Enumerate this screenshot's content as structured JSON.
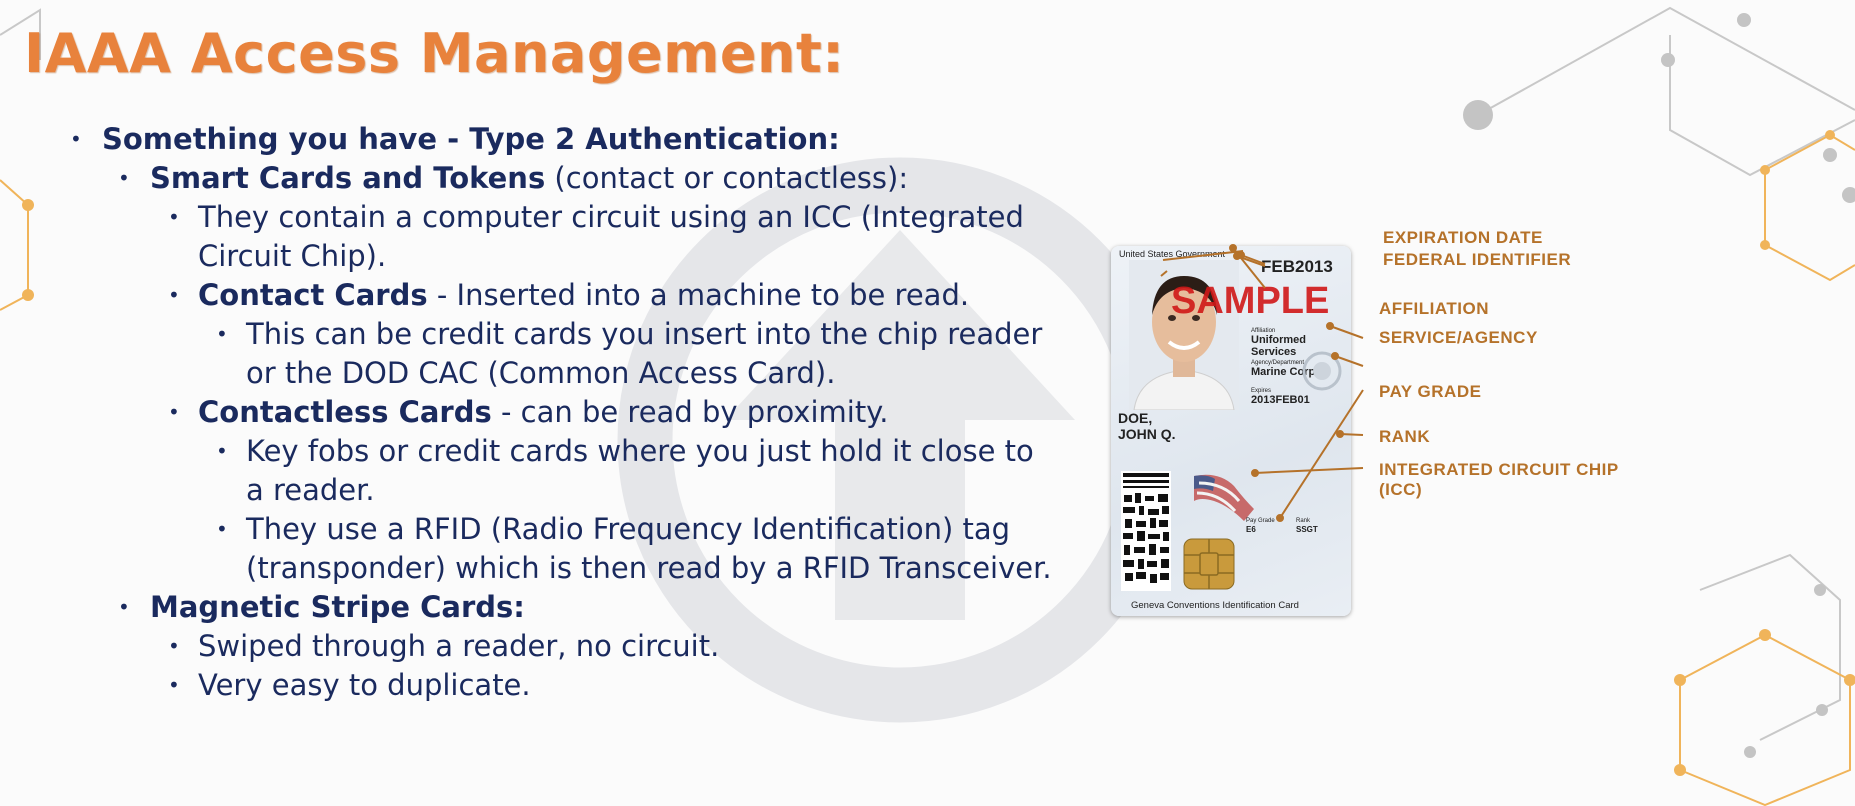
{
  "slide": {
    "title": "IAAA Access Management:",
    "bullets": [
      {
        "level": 1,
        "bold": "Something you have - Type 2 Authentication:",
        "text": ""
      },
      {
        "level": 2,
        "bold": "Smart Cards and Tokens",
        "text": " (contact or contactless):"
      },
      {
        "level": 3,
        "bold": "",
        "text": "They contain a computer circuit using an ICC (Integrated Circuit Chip)."
      },
      {
        "level": 3,
        "bold": "Contact Cards",
        "text": " - Inserted into a machine to be read."
      },
      {
        "level": 4,
        "bold": "",
        "text": "This can be credit cards you insert into the chip reader or the DOD CAC (Common Access Card)."
      },
      {
        "level": 3,
        "bold": "Contactless Cards",
        "text": " - can be read by proximity."
      },
      {
        "level": 4,
        "bold": "",
        "text": "Key fobs or credit cards where you just hold it close to a reader."
      },
      {
        "level": 4,
        "bold": "",
        "text": "They use a RFID (Radio Frequency Identification) tag (transponder) which is then read by a RFID Transceiver."
      },
      {
        "level": 2,
        "bold": "Magnetic Stripe Cards:",
        "text": ""
      },
      {
        "level": 3,
        "bold": "",
        "text": "Swiped through a reader, no circuit."
      },
      {
        "level": 3,
        "bold": "",
        "text": "Very easy to duplicate."
      }
    ]
  },
  "card": {
    "header": "United States Government",
    "expiry": "FEB2013",
    "sample": "SAMPLE",
    "affiliation_label": "Affiliation",
    "affiliation": "Uniformed Services",
    "agency_label": "Agency/Department",
    "agency": "Marine Corps",
    "expires_label": "Expires",
    "expires": "2013FEB01",
    "name_last": "DOE,",
    "name_first": "JOHN Q.",
    "pay_grade_label": "Pay Grade",
    "pay_grade": "E6",
    "rank_label": "Rank",
    "rank": "SSGT",
    "footer": "Geneva Conventions Identification Card"
  },
  "callouts": [
    "EXPIRATION DATE",
    "FEDERAL IDENTIFIER",
    "AFFILIATION",
    "SERVICE/AGENCY",
    "PAY GRADE",
    "RANK",
    "INTEGRATED CIRCUIT CHIP (ICC)"
  ],
  "colors": {
    "title": "#e8823c",
    "text": "#1a2a5e",
    "callout": "#b5722a",
    "sample": "#d01818"
  }
}
